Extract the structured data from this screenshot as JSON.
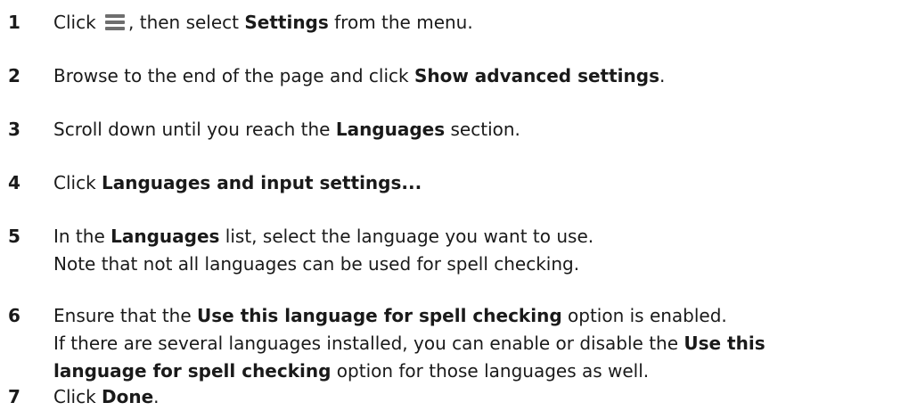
{
  "steps": [
    {
      "num": "1",
      "lines": [
        {
          "a": "Click",
          "b": ", then select ",
          "bold": "Settings",
          "c": " from the menu."
        }
      ]
    },
    {
      "num": "2",
      "lines": [
        {
          "a": "Browse to the end of the page and click ",
          "bold": "Show advanced settings",
          "c": "."
        }
      ]
    },
    {
      "num": "3",
      "lines": [
        {
          "a": "Scroll down until you reach the ",
          "bold": "Languages",
          "c": " section."
        }
      ]
    },
    {
      "num": "4",
      "lines": [
        {
          "a": "Click ",
          "bold": "Languages and input settings..."
        }
      ]
    },
    {
      "num": "5",
      "lines": [
        {
          "a": "In the ",
          "bold": "Languages",
          "c": " list, select the language you want to use."
        },
        {
          "a": "Note that not all languages can be used for spell checking."
        }
      ]
    },
    {
      "num": "6",
      "lines": [
        {
          "a": "Ensure that the ",
          "bold": "Use this language for spell checking",
          "c": " option is enabled."
        },
        {
          "a": "If there are several languages installed, you can enable or disable the ",
          "bold": "Use this"
        },
        {
          "bold": "language for spell checking",
          "c": " option for those languages as well."
        }
      ]
    },
    {
      "num": "7",
      "lines": [
        {
          "a": "Click ",
          "bold": "Done",
          "c": "."
        }
      ]
    }
  ],
  "icons": {
    "menu": "hamburger-menu-icon"
  }
}
